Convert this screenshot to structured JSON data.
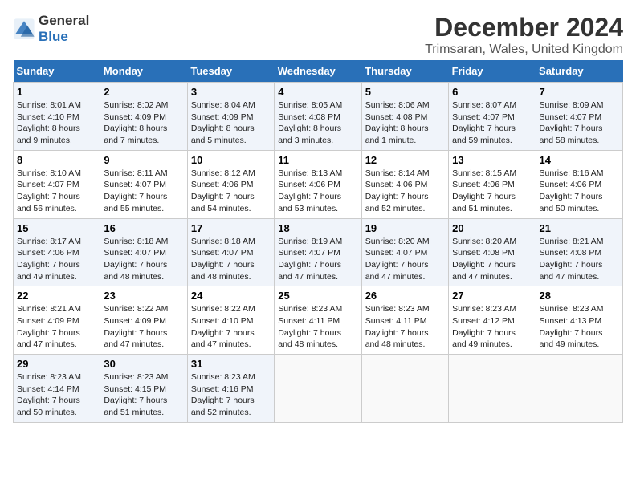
{
  "logo": {
    "line1": "General",
    "line2": "Blue"
  },
  "title": "December 2024",
  "subtitle": "Trimsaran, Wales, United Kingdom",
  "days_of_week": [
    "Sunday",
    "Monday",
    "Tuesday",
    "Wednesday",
    "Thursday",
    "Friday",
    "Saturday"
  ],
  "weeks": [
    [
      {
        "day": "1",
        "info": "Sunrise: 8:01 AM\nSunset: 4:10 PM\nDaylight: 8 hours\nand 9 minutes."
      },
      {
        "day": "2",
        "info": "Sunrise: 8:02 AM\nSunset: 4:09 PM\nDaylight: 8 hours\nand 7 minutes."
      },
      {
        "day": "3",
        "info": "Sunrise: 8:04 AM\nSunset: 4:09 PM\nDaylight: 8 hours\nand 5 minutes."
      },
      {
        "day": "4",
        "info": "Sunrise: 8:05 AM\nSunset: 4:08 PM\nDaylight: 8 hours\nand 3 minutes."
      },
      {
        "day": "5",
        "info": "Sunrise: 8:06 AM\nSunset: 4:08 PM\nDaylight: 8 hours\nand 1 minute."
      },
      {
        "day": "6",
        "info": "Sunrise: 8:07 AM\nSunset: 4:07 PM\nDaylight: 7 hours\nand 59 minutes."
      },
      {
        "day": "7",
        "info": "Sunrise: 8:09 AM\nSunset: 4:07 PM\nDaylight: 7 hours\nand 58 minutes."
      }
    ],
    [
      {
        "day": "8",
        "info": "Sunrise: 8:10 AM\nSunset: 4:07 PM\nDaylight: 7 hours\nand 56 minutes."
      },
      {
        "day": "9",
        "info": "Sunrise: 8:11 AM\nSunset: 4:07 PM\nDaylight: 7 hours\nand 55 minutes."
      },
      {
        "day": "10",
        "info": "Sunrise: 8:12 AM\nSunset: 4:06 PM\nDaylight: 7 hours\nand 54 minutes."
      },
      {
        "day": "11",
        "info": "Sunrise: 8:13 AM\nSunset: 4:06 PM\nDaylight: 7 hours\nand 53 minutes."
      },
      {
        "day": "12",
        "info": "Sunrise: 8:14 AM\nSunset: 4:06 PM\nDaylight: 7 hours\nand 52 minutes."
      },
      {
        "day": "13",
        "info": "Sunrise: 8:15 AM\nSunset: 4:06 PM\nDaylight: 7 hours\nand 51 minutes."
      },
      {
        "day": "14",
        "info": "Sunrise: 8:16 AM\nSunset: 4:06 PM\nDaylight: 7 hours\nand 50 minutes."
      }
    ],
    [
      {
        "day": "15",
        "info": "Sunrise: 8:17 AM\nSunset: 4:06 PM\nDaylight: 7 hours\nand 49 minutes."
      },
      {
        "day": "16",
        "info": "Sunrise: 8:18 AM\nSunset: 4:07 PM\nDaylight: 7 hours\nand 48 minutes."
      },
      {
        "day": "17",
        "info": "Sunrise: 8:18 AM\nSunset: 4:07 PM\nDaylight: 7 hours\nand 48 minutes."
      },
      {
        "day": "18",
        "info": "Sunrise: 8:19 AM\nSunset: 4:07 PM\nDaylight: 7 hours\nand 47 minutes."
      },
      {
        "day": "19",
        "info": "Sunrise: 8:20 AM\nSunset: 4:07 PM\nDaylight: 7 hours\nand 47 minutes."
      },
      {
        "day": "20",
        "info": "Sunrise: 8:20 AM\nSunset: 4:08 PM\nDaylight: 7 hours\nand 47 minutes."
      },
      {
        "day": "21",
        "info": "Sunrise: 8:21 AM\nSunset: 4:08 PM\nDaylight: 7 hours\nand 47 minutes."
      }
    ],
    [
      {
        "day": "22",
        "info": "Sunrise: 8:21 AM\nSunset: 4:09 PM\nDaylight: 7 hours\nand 47 minutes."
      },
      {
        "day": "23",
        "info": "Sunrise: 8:22 AM\nSunset: 4:09 PM\nDaylight: 7 hours\nand 47 minutes."
      },
      {
        "day": "24",
        "info": "Sunrise: 8:22 AM\nSunset: 4:10 PM\nDaylight: 7 hours\nand 47 minutes."
      },
      {
        "day": "25",
        "info": "Sunrise: 8:23 AM\nSunset: 4:11 PM\nDaylight: 7 hours\nand 48 minutes."
      },
      {
        "day": "26",
        "info": "Sunrise: 8:23 AM\nSunset: 4:11 PM\nDaylight: 7 hours\nand 48 minutes."
      },
      {
        "day": "27",
        "info": "Sunrise: 8:23 AM\nSunset: 4:12 PM\nDaylight: 7 hours\nand 49 minutes."
      },
      {
        "day": "28",
        "info": "Sunrise: 8:23 AM\nSunset: 4:13 PM\nDaylight: 7 hours\nand 49 minutes."
      }
    ],
    [
      {
        "day": "29",
        "info": "Sunrise: 8:23 AM\nSunset: 4:14 PM\nDaylight: 7 hours\nand 50 minutes."
      },
      {
        "day": "30",
        "info": "Sunrise: 8:23 AM\nSunset: 4:15 PM\nDaylight: 7 hours\nand 51 minutes."
      },
      {
        "day": "31",
        "info": "Sunrise: 8:23 AM\nSunset: 4:16 PM\nDaylight: 7 hours\nand 52 minutes."
      },
      {
        "day": "",
        "info": ""
      },
      {
        "day": "",
        "info": ""
      },
      {
        "day": "",
        "info": ""
      },
      {
        "day": "",
        "info": ""
      }
    ]
  ]
}
